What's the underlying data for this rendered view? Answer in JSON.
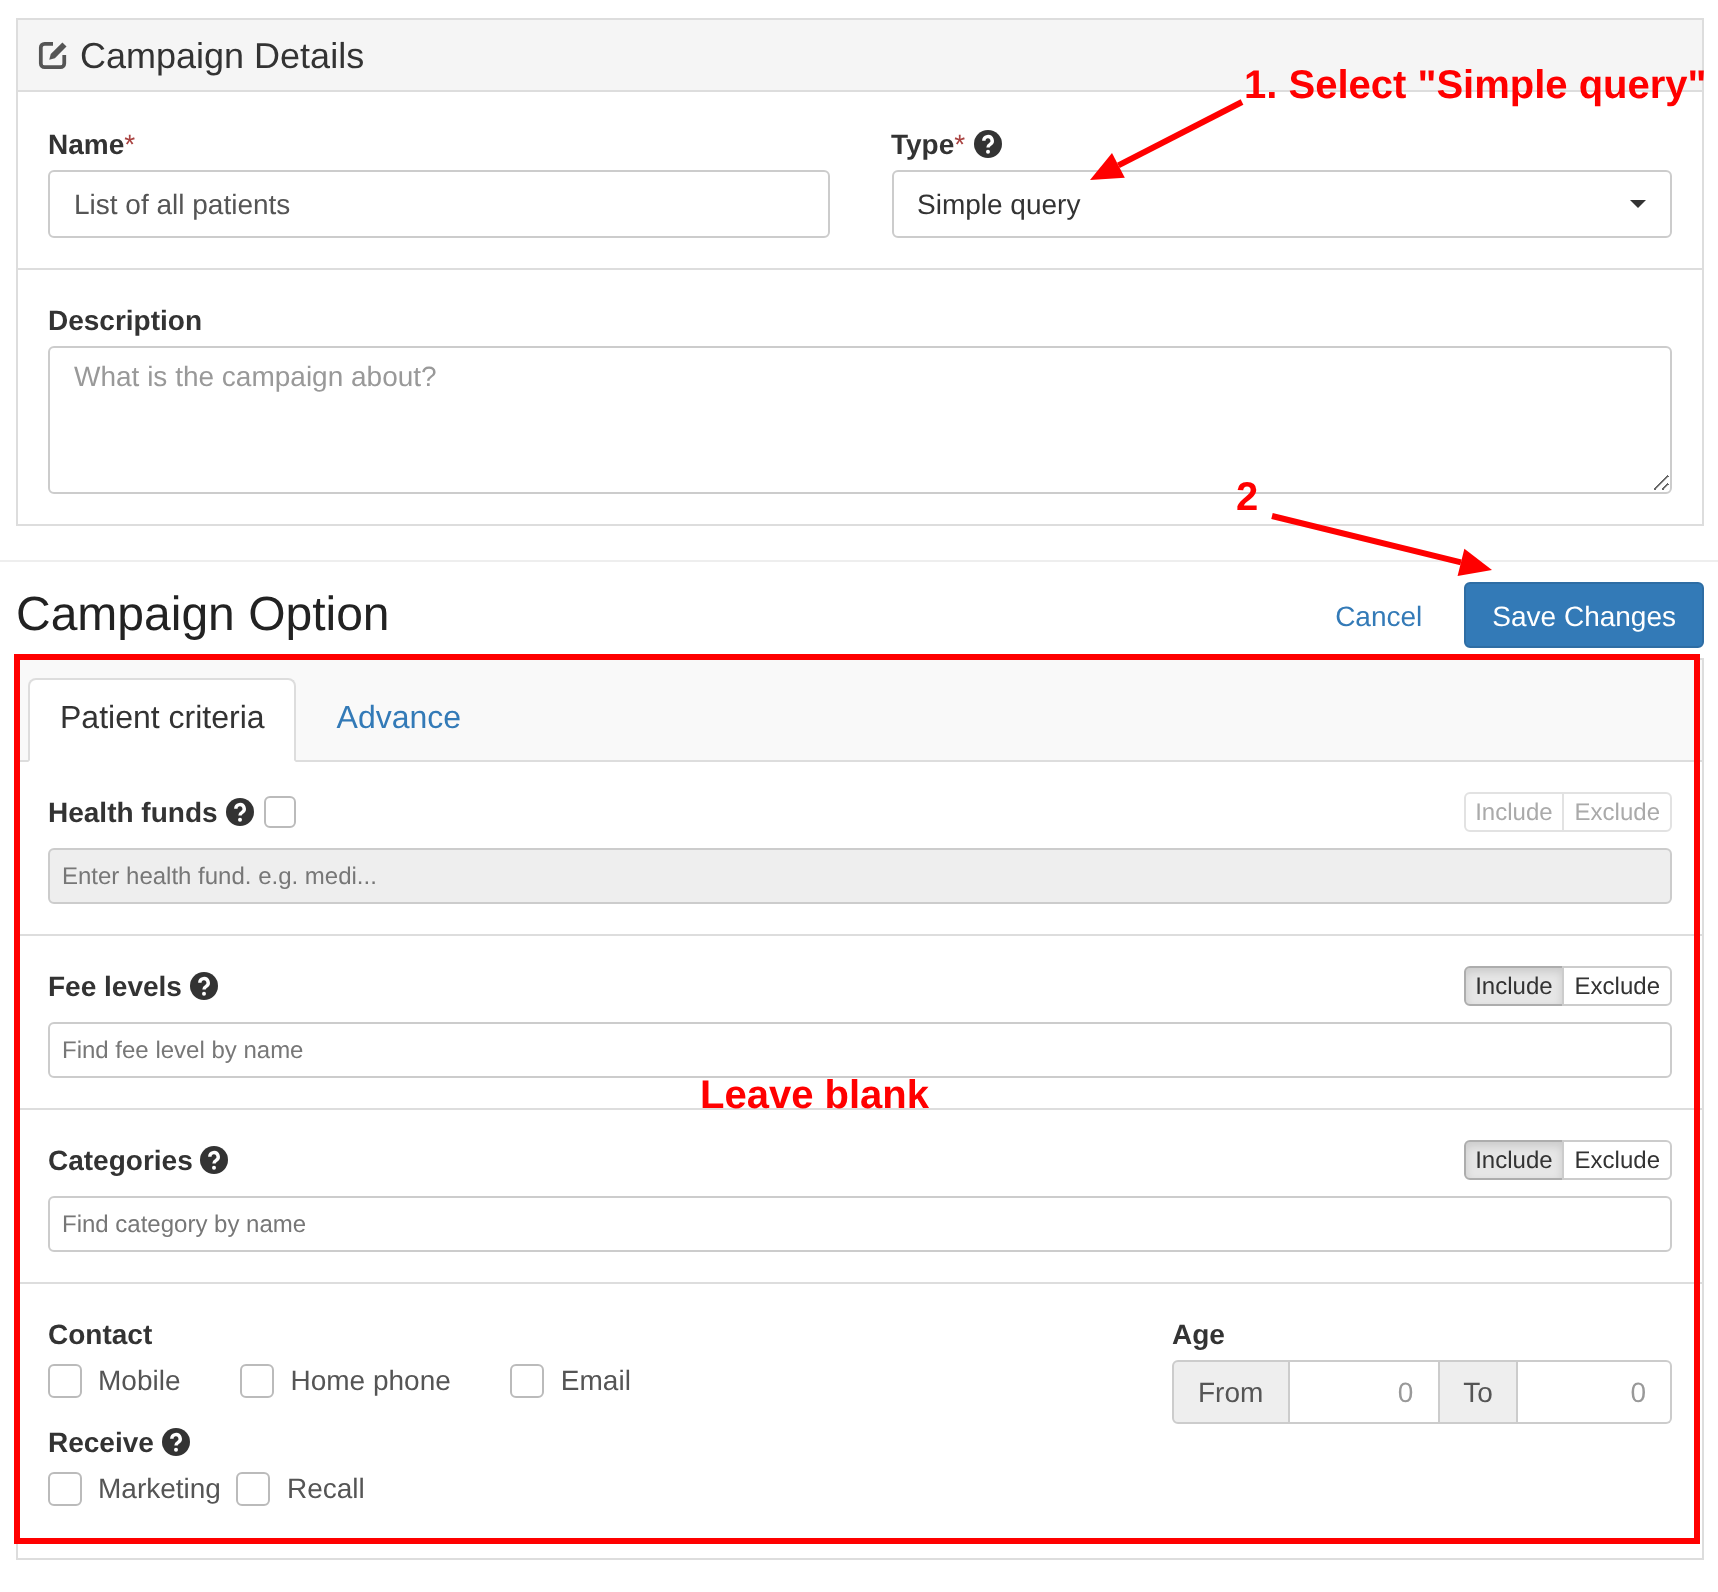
{
  "campaign_details": {
    "title": "Campaign Details",
    "fields": [
      {
        "kind": "text",
        "label": "Name",
        "required_mark": "*",
        "help": false,
        "value": "List of all patients"
      },
      {
        "kind": "select",
        "label": "Type",
        "required_mark": "*",
        "help": true,
        "value": "Simple query"
      }
    ],
    "description": {
      "label": "Description",
      "placeholder": "What is the campaign about?"
    }
  },
  "campaign_option": {
    "title": "Campaign Option",
    "cancel": "Cancel",
    "save": "Save Changes"
  },
  "tabs": [
    {
      "label": "Patient criteria",
      "selected": true
    },
    {
      "label": "Advance",
      "selected": false
    }
  ],
  "criteria": [
    {
      "label": "Health funds",
      "help": true,
      "checked": false,
      "disabled": true,
      "placeholder": "Enter health fund. e.g. medi...",
      "toggle": [
        {
          "label": "Include",
          "selected": false
        },
        {
          "label": "Exclude",
          "selected": false
        }
      ]
    },
    {
      "label": "Fee levels",
      "help": true,
      "disabled": false,
      "placeholder": "Find fee level by name",
      "toggle": [
        {
          "label": "Include",
          "selected": true
        },
        {
          "label": "Exclude",
          "selected": false
        }
      ]
    },
    {
      "label": "Categories",
      "help": true,
      "disabled": false,
      "placeholder": "Find category by name",
      "toggle": [
        {
          "label": "Include",
          "selected": true
        },
        {
          "label": "Exclude",
          "selected": false
        }
      ]
    }
  ],
  "contact_groups": [
    {
      "label": "Contact",
      "help": false,
      "options": [
        {
          "label": "Mobile",
          "checked": false
        },
        {
          "label": "Home phone",
          "checked": false
        },
        {
          "label": "Email",
          "checked": false
        }
      ]
    },
    {
      "label": "Receive",
      "help": true,
      "options": [
        {
          "label": "Marketing",
          "checked": false
        },
        {
          "label": "Recall",
          "checked": false
        }
      ]
    }
  ],
  "age": {
    "label": "Age",
    "from": {
      "addon": "From",
      "placeholder": "0"
    },
    "to": {
      "addon": "To",
      "placeholder": "0"
    }
  },
  "annotations": [
    {
      "kind": "callout",
      "text": "1. Select \"Simple query\""
    },
    {
      "kind": "callout",
      "text": "2"
    },
    {
      "kind": "note",
      "text": "Leave blank"
    },
    {
      "kind": "frame"
    }
  ]
}
